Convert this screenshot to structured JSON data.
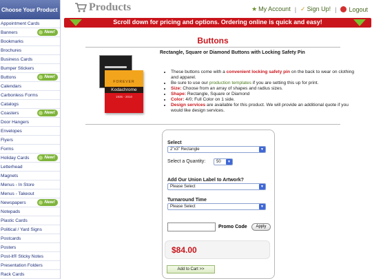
{
  "sidebar": {
    "heading": "Choose Your Product",
    "items": [
      {
        "label": "Appointment Cards",
        "badge": ""
      },
      {
        "label": "Banners",
        "badge": "New!"
      },
      {
        "label": "Bookmarks",
        "badge": ""
      },
      {
        "label": "Brochures",
        "badge": ""
      },
      {
        "label": "Business Cards",
        "badge": ""
      },
      {
        "label": "Bumper Stickers",
        "badge": ""
      },
      {
        "label": "Buttons",
        "badge": "New!"
      },
      {
        "label": "Calendars",
        "badge": ""
      },
      {
        "label": "Carbonless Forms",
        "badge": ""
      },
      {
        "label": "Catalogs",
        "badge": ""
      },
      {
        "label": "Coasters",
        "badge": "New!"
      },
      {
        "label": "Door Hangers",
        "badge": ""
      },
      {
        "label": "Envelopes",
        "badge": ""
      },
      {
        "label": "Flyers",
        "badge": ""
      },
      {
        "label": "Forms",
        "badge": ""
      },
      {
        "label": "Holiday Cards",
        "badge": "New!"
      },
      {
        "label": "Letterhead",
        "badge": ""
      },
      {
        "label": "Magnets",
        "badge": ""
      },
      {
        "label": "Menus - In Store",
        "badge": ""
      },
      {
        "label": "Menus - Takeout",
        "badge": ""
      },
      {
        "label": "Newspapers",
        "badge": "New!"
      },
      {
        "label": "Notepads",
        "badge": ""
      },
      {
        "label": "Plastic Cards",
        "badge": ""
      },
      {
        "label": "Political / Yard Signs",
        "badge": ""
      },
      {
        "label": "Postcards",
        "badge": ""
      },
      {
        "label": "Posters",
        "badge": ""
      },
      {
        "label": "Post-it® Sticky Notes",
        "badge": ""
      },
      {
        "label": "Presentation Folders",
        "badge": ""
      },
      {
        "label": "Rack Cards",
        "badge": ""
      }
    ]
  },
  "header": {
    "title": "Products",
    "links": {
      "account": "My Account",
      "signup": "Sign Up!",
      "logout": "Logout"
    }
  },
  "banner": {
    "text": "Scroll down for pricing and options. Ordering online is quick and easy!"
  },
  "main": {
    "title": "Buttons",
    "subtitle": "Rectangle, Square or Diamond Buttons with Locking Safety Pin",
    "image": {
      "forever": "FOREVER",
      "brand": "Kodachrome",
      "years": "1935 - 2010"
    },
    "bullets": {
      "b1_a": "These buttons come with a ",
      "b1_hl": "convenient locking safety pin",
      "b1_b": " on the back to wear on clothing and apparel.",
      "b2_a": "Be sure to use our ",
      "b2_hl": "production templates",
      "b2_b": " if you are setting this up for print.",
      "b3_k": "Size:",
      "b3_v": " Choose from an array of shapes and radius sizes.",
      "b4_k": "Shape:",
      "b4_v": " Rectangle, Square or Diamond",
      "b5_k": "Color:",
      "b5_v": " 4/0; Full Color on 1 side.",
      "b6_hl": "Design services",
      "b6_v": " are available for this product. We will provide an additional quote if you would like design services."
    }
  },
  "order": {
    "select_label": "Select",
    "select_value": "2\"x3\" Rectangle",
    "quantity_label": "Select a Quantity:",
    "quantity_value": "50",
    "union_label": "Add Our Union Label to Artwork?",
    "union_value": "Please Select",
    "turnaround_label": "Turnaround Time",
    "turnaround_value": "Please Select",
    "promo_label": "Promo Code",
    "promo_value": "",
    "apply_label": "Apply",
    "price": "$84.00",
    "cart_label": "Add to Cart >>"
  },
  "colors": {
    "accent_red": "#c8161d",
    "nav_blue": "#1d2f7a",
    "badge_green": "#7fb43d"
  }
}
